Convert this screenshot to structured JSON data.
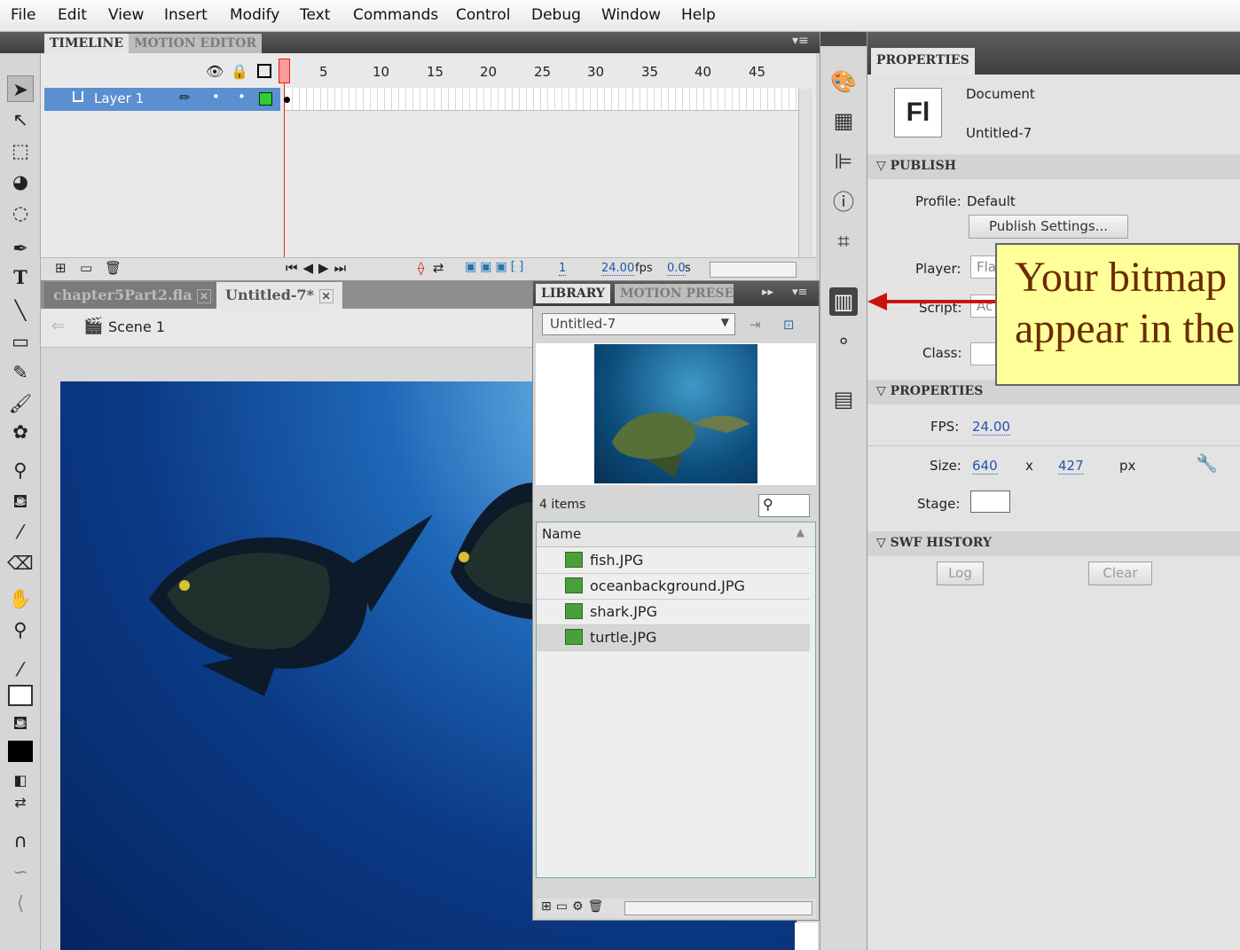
{
  "menu": [
    "File",
    "Edit",
    "View",
    "Insert",
    "Modify",
    "Text",
    "Commands",
    "Control",
    "Debug",
    "Window",
    "Help"
  ],
  "timeline": {
    "tabs": [
      "TIMELINE",
      "MOTION EDITOR"
    ],
    "frame_numbers": [
      "5",
      "10",
      "15",
      "20",
      "25",
      "30",
      "35",
      "40",
      "45"
    ],
    "layer_name": "Layer 1",
    "current_frame": "1",
    "fps": "24.00",
    "fps_unit": "fps",
    "elapsed": "0.0",
    "elapsed_unit": "s"
  },
  "documents": {
    "tabs": [
      "chapter5Part2.fla",
      "Untitled-7*"
    ],
    "scene": "Scene 1"
  },
  "library": {
    "tabs": [
      "LIBRARY",
      "MOTION PRESET"
    ],
    "doc_select": "Untitled-7",
    "count": "4 items",
    "column": "Name",
    "items": [
      "fish.JPG",
      "oceanbackground.JPG",
      "shark.JPG",
      "turtle.JPG"
    ],
    "selected_index": 3
  },
  "properties": {
    "tab": "PROPERTIES",
    "doc_type": "Document",
    "doc_name": "Untitled-7",
    "fl_logo": "Fl",
    "publish_header": "PUBLISH",
    "profile_label": "Profile:",
    "profile_value": "Default",
    "publish_settings": "Publish Settings...",
    "player_label": "Player:",
    "player_value": "Fla",
    "script_label": "Script:",
    "script_value": "Ac",
    "class_label": "Class:",
    "props_header": "PROPERTIES",
    "fps_label": "FPS:",
    "fps_value": "24.00",
    "size_label": "Size:",
    "width": "640",
    "x": "x",
    "height": "427",
    "unit": "px",
    "stage_label": "Stage:",
    "swf_header": "SWF HISTORY",
    "log": "Log",
    "clear": "Clear"
  },
  "callout": {
    "line1": "Your bitmap",
    "line2": "appear in the"
  }
}
